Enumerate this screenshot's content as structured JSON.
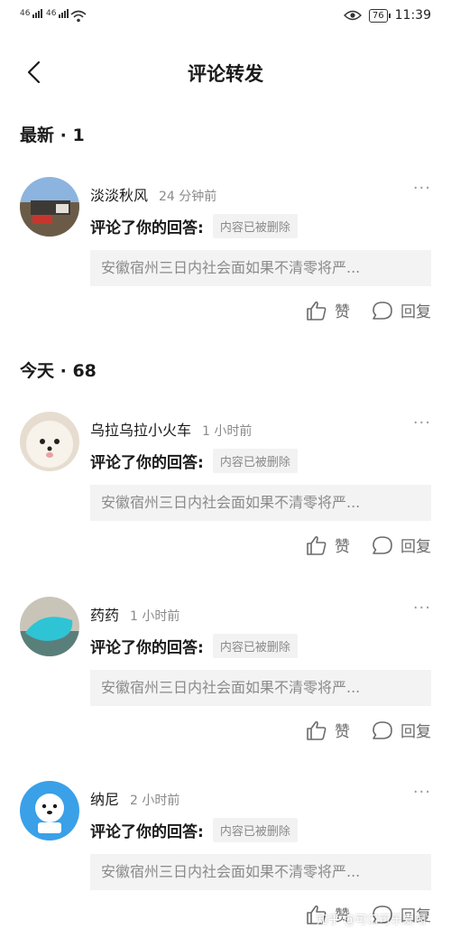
{
  "status_bar": {
    "signal_1": "46",
    "signal_2": "46",
    "wifi_icon": "wifi-icon",
    "eye_icon": "eye-icon",
    "battery": "76",
    "time": "11:39"
  },
  "header": {
    "title": "评论转发",
    "back_icon": "chevron-left-icon"
  },
  "sections": [
    {
      "heading": "最新 · 1"
    },
    {
      "heading": "今天 · 68"
    }
  ],
  "items": [
    {
      "name": "淡淡秋风",
      "time": "24 分钟前",
      "action": "评论了你的回答:",
      "status": "内容已被删除",
      "quote": "安徽宿州三日内社会面如果不清零将严...",
      "like": "赞",
      "reply": "回复"
    },
    {
      "name": "乌拉乌拉小火车",
      "time": "1 小时前",
      "action": "评论了你的回答:",
      "status": "内容已被删除",
      "quote": "安徽宿州三日内社会面如果不清零将严...",
      "like": "赞",
      "reply": "回复"
    },
    {
      "name": "药药",
      "time": "1 小时前",
      "action": "评论了你的回答:",
      "status": "内容已被删除",
      "quote": "安徽宿州三日内社会面如果不清零将严...",
      "like": "赞",
      "reply": "回复"
    },
    {
      "name": "纳尼",
      "time": "2 小时前",
      "action": "评论了你的回答:",
      "status": "内容已被删除",
      "quote": "安徽宿州三日内社会面如果不清零将严...",
      "like": "赞",
      "reply": "回复"
    }
  ],
  "watermark": "知乎 @可口可乐爱喝"
}
